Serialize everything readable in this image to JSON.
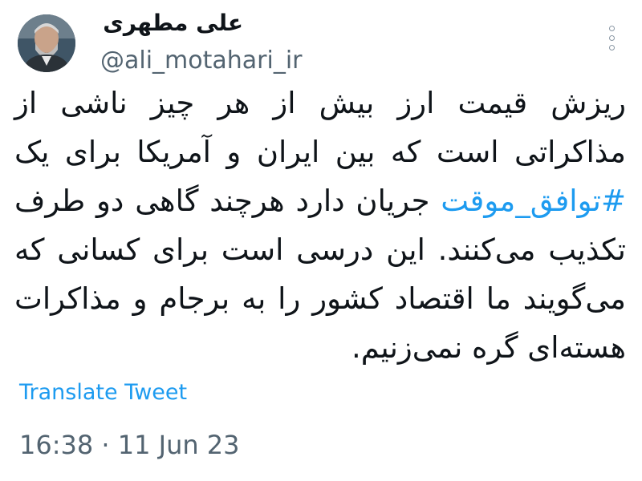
{
  "author": {
    "display_name": "علی مطهری",
    "handle": "@ali_motahari_ir"
  },
  "menu": {
    "icon": "more-vertical-icon"
  },
  "tweet": {
    "text_before_hashtag": "ریزش قیمت ارز بیش از هر چیز ناشی از مذاکراتی است که بین ایران و آمریکا برای یک ",
    "hashtag": "#توافق_موقت",
    "text_after_hashtag": " جریان دارد هرچند گاهی دو طرف تکذیب می‌کنند. این درسی است برای کسانی که می‌گویند ما اقتصاد کشور را به برجام و مذاکرات هسته‌ای گره نمی‌زنیم."
  },
  "translate_label": "Translate Tweet",
  "timestamp": "16:38 · 11 Jun 23",
  "colors": {
    "link": "#1d9bf0",
    "text": "#0f1419",
    "secondary": "#536471"
  }
}
